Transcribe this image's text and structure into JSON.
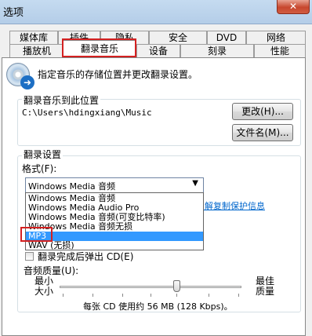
{
  "window": {
    "title": "选项",
    "close": "✕"
  },
  "tabs": {
    "row1": [
      "媒体库",
      "插件",
      "隐私",
      "安全",
      "DVD",
      "网络"
    ],
    "row2": [
      "播放机",
      "翻录音乐",
      "设备",
      "刻录",
      "性能"
    ],
    "active": "翻录音乐"
  },
  "intro": "指定音乐的存储位置并更改翻录设置。",
  "location": {
    "group_title": "翻录音乐到此位置",
    "path": "C:\\Users\\hdingxiang\\Music",
    "change_button": "更改(H)...",
    "filename_button": "文件名(M)..."
  },
  "settings": {
    "group_title": "翻录设置",
    "format_label": "格式(F):",
    "format_value": "Windows Media 音频",
    "format_options": [
      "Windows Media 音频",
      "Windows Media Audio Pro",
      "Windows Media 音频(可变比特率)",
      "Windows Media 音频无损",
      "MP3",
      "WAV (无损)"
    ],
    "format_selected": "MP3",
    "copy_protect_link": "了解复制保护信息",
    "eject_label": "翻录完成后弹出 CD(E)",
    "quality_label": "音频质量(U):",
    "quality_min": "最小\n大小",
    "quality_max": "最佳\n质量",
    "quality_info": "每张 CD 使用约 56 MB (128 Kbps)。"
  }
}
